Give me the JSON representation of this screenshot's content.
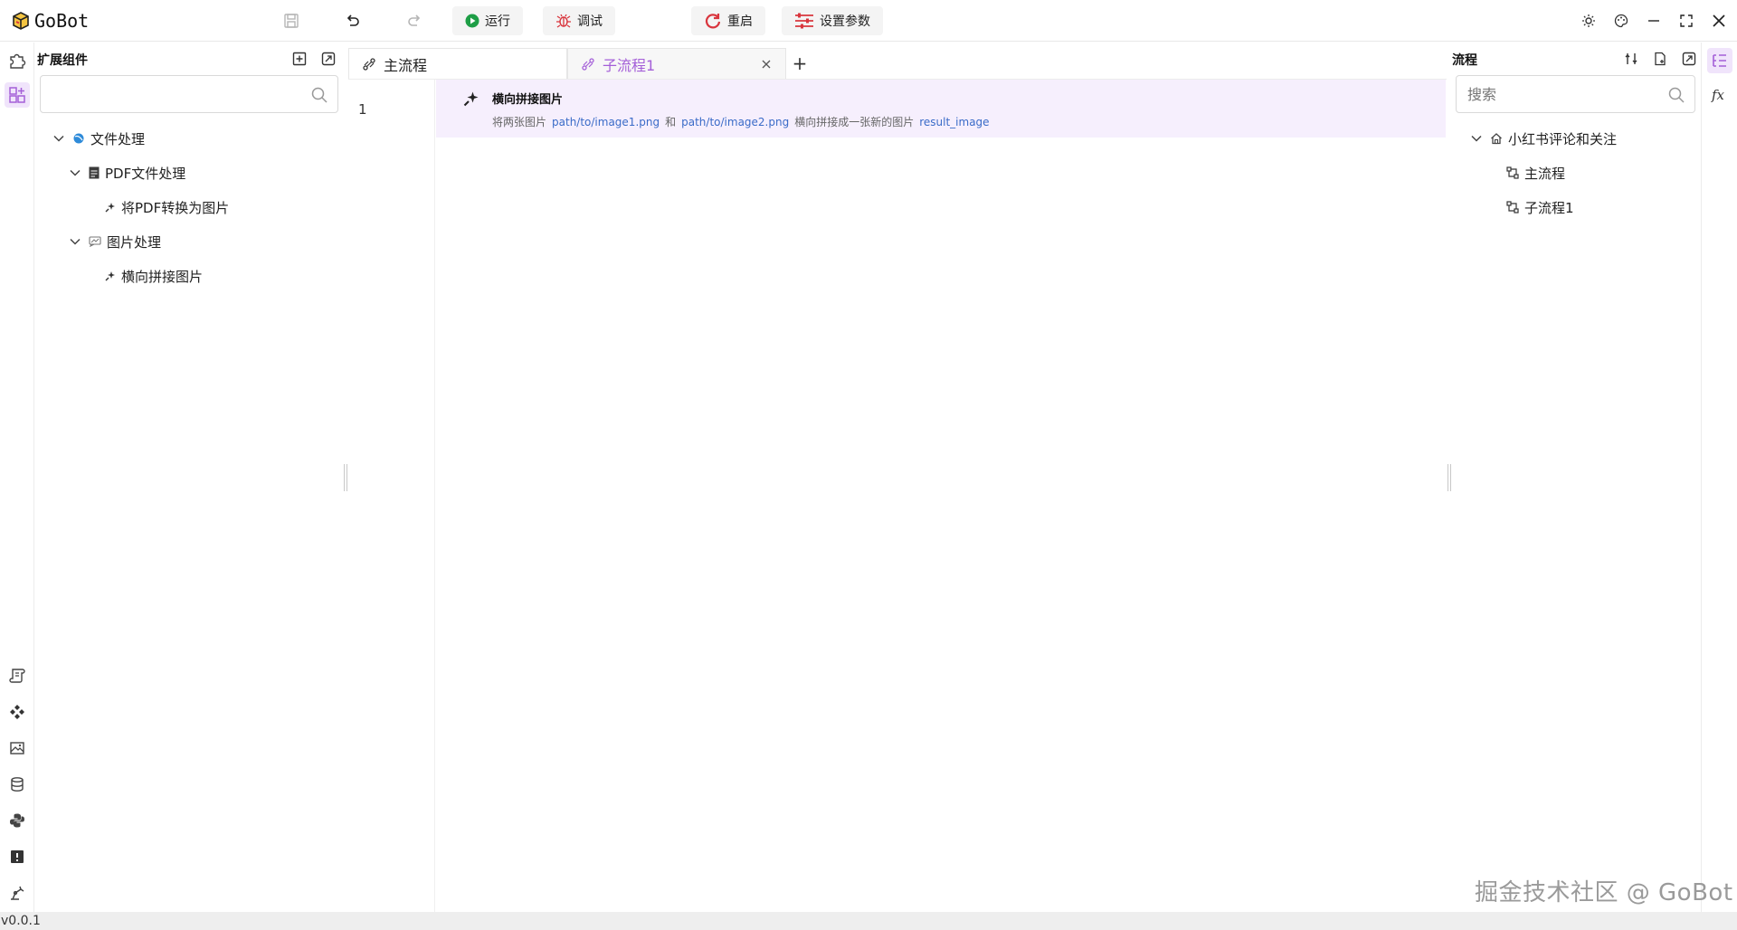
{
  "app": {
    "name": "GoBot",
    "version": "v0.0.1"
  },
  "toolbar": {
    "run_label": "运行",
    "debug_label": "调试",
    "restart_label": "重启",
    "settings_label": "设置参数"
  },
  "left_panel": {
    "title": "扩展组件",
    "search_placeholder": "",
    "tree": [
      {
        "label": "文件处理",
        "expanded": true
      },
      {
        "label": "PDF文件处理",
        "expanded": true
      },
      {
        "label": "将PDF转换为图片"
      },
      {
        "label": "图片处理",
        "expanded": true
      },
      {
        "label": "横向拼接图片"
      }
    ]
  },
  "editor": {
    "tabs": [
      {
        "label": "主流程",
        "active": true
      },
      {
        "label": "子流程1",
        "active": false
      }
    ],
    "add_tab": "+",
    "lines": [
      {
        "number": "1",
        "title": "横向拼接图片",
        "desc": {
          "p1": "将两张图片",
          "v1": "path/to/image1.png",
          "p2": "和",
          "v2": "path/to/image2.png",
          "p3": "横向拼接成一张新的图片",
          "v3": "result_image"
        }
      }
    ]
  },
  "right_panel": {
    "title": "流程",
    "search_placeholder": "搜索",
    "tree": [
      {
        "label": "小红书评论和关注",
        "expanded": true
      },
      {
        "label": "主流程"
      },
      {
        "label": "子流程1"
      }
    ]
  },
  "watermark": "掘金技术社区 @ GoBot",
  "colors": {
    "accent": "#a45fd8",
    "highlight": "#f6effd",
    "link": "#3a6bc8",
    "run": "#1e9e46",
    "danger": "#d9363e"
  }
}
